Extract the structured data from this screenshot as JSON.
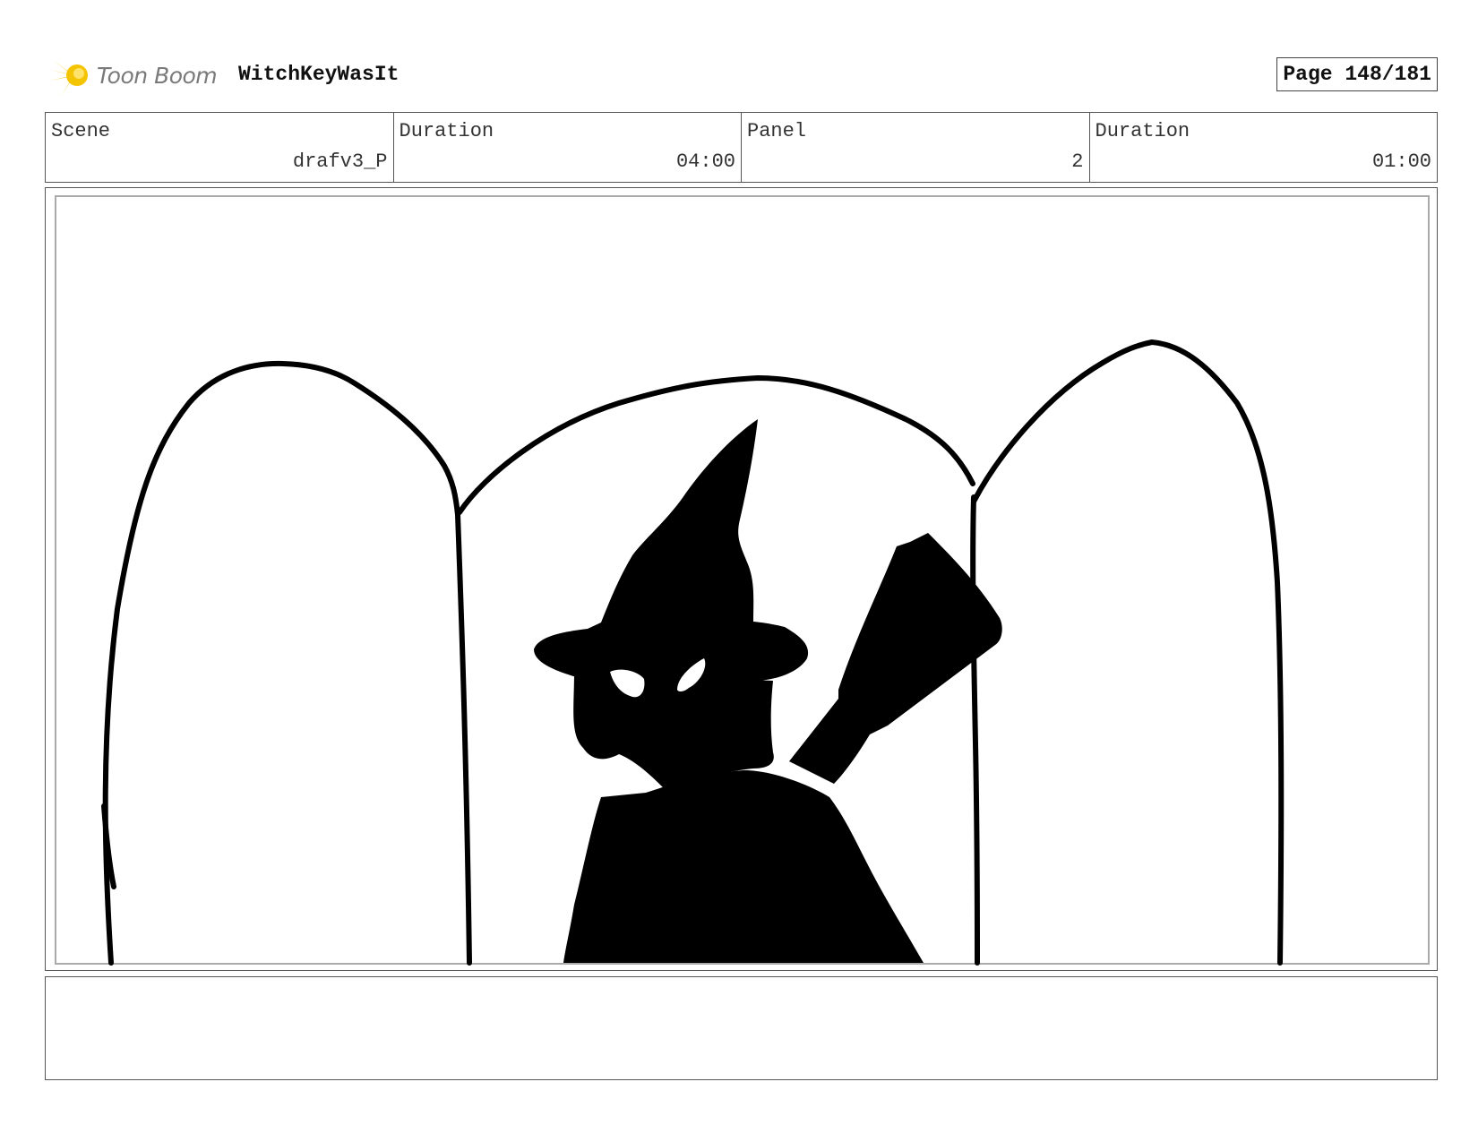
{
  "header": {
    "logo_text": "Toon Boom",
    "project_title": "WitchKeyWasIt",
    "page_label": "Page 148/181"
  },
  "info": {
    "scene_label": "Scene",
    "scene_value": "drafv3_P",
    "scene_duration_label": "Duration",
    "scene_duration_value": "04:00",
    "panel_label": "Panel",
    "panel_value": "2",
    "panel_duration_label": "Duration",
    "panel_duration_value": "01:00"
  },
  "colors": {
    "logo_star": "#f5c400",
    "ink": "#000000"
  }
}
